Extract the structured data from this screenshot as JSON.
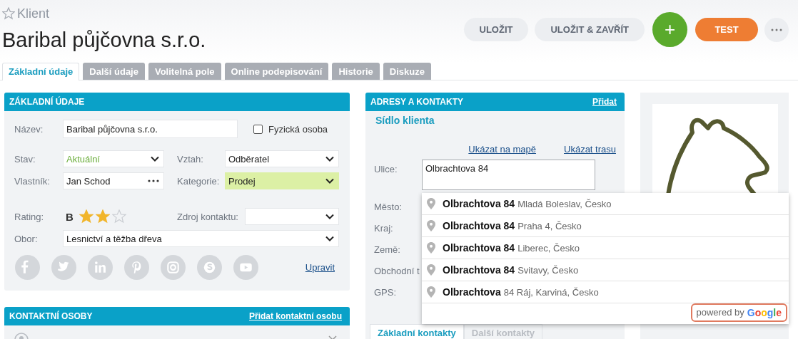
{
  "record_type": "Klient",
  "favorite": false,
  "title": "Baribal půjčovna s.r.o.",
  "actions": [
    {
      "label": "ULOŽIT",
      "kind": "secondary"
    },
    {
      "label": "ULOŽIT & ZAVŘÍT",
      "kind": "secondary"
    },
    {
      "label": "+",
      "kind": "add"
    },
    {
      "label": "TEST",
      "kind": "accent"
    },
    {
      "kind": "more"
    }
  ],
  "tabs": [
    {
      "label": "Základní údaje",
      "selected": true
    },
    {
      "label": "Další údaje",
      "selected": false
    },
    {
      "label": "Volitelná pole",
      "selected": false
    },
    {
      "label": "Online podepisování",
      "selected": false
    },
    {
      "label": "Historie",
      "selected": false
    },
    {
      "label": "Diskuze",
      "selected": false
    }
  ],
  "basic": {
    "title": "ZÁKLADNÍ ÚDAJE",
    "name": {
      "label": "Název:",
      "value": "Baribal půjčovna s.r.o."
    },
    "natural_person": {
      "label": "Fyzická osoba",
      "checked": false
    },
    "status": {
      "label": "Stav:",
      "value": "Aktuální"
    },
    "relation": {
      "label": "Vztah:",
      "value": "Odběratel"
    },
    "owner": {
      "label": "Vlastník:",
      "value": "Jan Schod"
    },
    "category": {
      "label": "Kategorie:",
      "value": "Prodej",
      "highlighted": true
    },
    "rating": {
      "label": "Rating:",
      "grade": "B",
      "stars": 2
    },
    "source": {
      "label": "Zdroj kontaktu:"
    },
    "industry": {
      "label": "Obor:",
      "value": "Lesnictví a těžba dřeva"
    },
    "socials": [
      {
        "kind": "facebook"
      },
      {
        "kind": "twitter"
      },
      {
        "kind": "linkedin"
      },
      {
        "kind": "pinterest"
      },
      {
        "kind": "instagram"
      },
      {
        "kind": "skype"
      },
      {
        "kind": "youtube"
      }
    ],
    "edit_link": "Upravit"
  },
  "contacts": {
    "title": "KONTAKTNÍ OSOBY",
    "add_link": "Přidat kontaktní osobu"
  },
  "addresses": {
    "title": "ADRESY A KONTAKTY",
    "add_link": "Přidat",
    "section": "Sídlo klienta",
    "links": [
      "Ukázat na mapě",
      "Ukázat trasu"
    ],
    "fields": [
      {
        "label": "Ulice:",
        "value": "Olbrachtova 84",
        "kind": "textarea"
      },
      {
        "label": "Město:",
        "kind": "hidden"
      },
      {
        "label": "Kraj:",
        "kind": "hidden"
      },
      {
        "label": "Země:",
        "kind": "hidden"
      },
      {
        "label": "Obchodní t",
        "kind": "hidden"
      },
      {
        "label": "GPS:",
        "kind": "hidden"
      }
    ],
    "tabs": [
      {
        "label": "Základní kontakty",
        "selected": true
      },
      {
        "label": "Další kontakty",
        "selected": false
      }
    ]
  },
  "suggestions": [
    {
      "main": "Olbrachtova 84",
      "secondary": "Mladá Boleslav, Česko"
    },
    {
      "main": "Olbrachtova 84",
      "secondary": "Praha 4, Česko"
    },
    {
      "main": "Olbrachtova 84",
      "secondary": "Liberec, Česko"
    },
    {
      "main": "Olbrachtova 84",
      "secondary": "Svitavy, Česko"
    },
    {
      "main": "Olbrachtova",
      "secondary": "84 Ráj, Karviná, Česko"
    }
  ],
  "attribution": {
    "prefix": "powered by",
    "brand": "Google"
  }
}
